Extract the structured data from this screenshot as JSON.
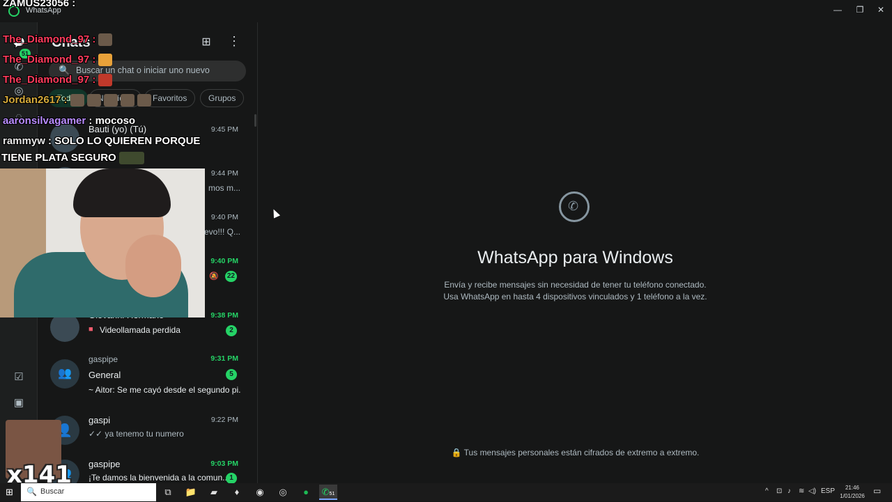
{
  "window": {
    "title": "WhatsApp",
    "controls": [
      "—",
      "❐",
      "✕"
    ]
  },
  "rail": {
    "badge": "51",
    "icons": [
      "chats-icon",
      "calls-icon",
      "status-icon",
      "channels-icon",
      "communities-icon",
      "starred-icon",
      "media-icon"
    ]
  },
  "sidebar": {
    "title": "Chats",
    "search_placeholder": "Buscar un chat o iniciar uno nuevo",
    "filters": [
      "Todos",
      "No leídos",
      "Favoritos",
      "Grupos"
    ],
    "chats": [
      {
        "name": "Bauti (yo) (Tú)",
        "sub": "",
        "time": "9:45 PM",
        "time_green": false,
        "badge": ""
      },
      {
        "name": "",
        "sub": "mos m...",
        "time": "9:44 PM",
        "time_green": false,
        "badge": ""
      },
      {
        "name": "",
        "sub": "evo!!! Q...",
        "time": "9:40 PM",
        "time_green": false,
        "badge": ""
      },
      {
        "name": "",
        "sub": "",
        "time": "9:40 PM",
        "time_green": true,
        "badge": "22",
        "muted": true
      },
      {
        "name": "Giovanni Hermano",
        "sub": "Videollamada perdida",
        "time": "9:38 PM",
        "time_green": true,
        "badge": "2"
      },
      {
        "name": "gaspipe",
        "title2": "General",
        "sub": "~ Aitor: Se me cayó desde el segundo pi...",
        "time": "9:31 PM",
        "time_green": true,
        "badge": "5"
      },
      {
        "name": "gaspi",
        "sub": "✓✓ ya tenemo tu numero",
        "time": "9:22 PM",
        "time_green": false,
        "badge": ""
      },
      {
        "name": "gaspipe",
        "sub": "¡Te damos la bienvenida a la comun...",
        "time": "9:03 PM",
        "time_green": true,
        "badge": "1"
      }
    ]
  },
  "main": {
    "title": "WhatsApp para Windows",
    "line1": "Envía y recibe mensajes sin necesidad de tener tu teléfono conectado.",
    "line2": "Usa WhatsApp en hasta 4 dispositivos vinculados y 1 teléfono a la vez.",
    "encrypt": "Tus mensajes personales están cifrados de extremo a extremo."
  },
  "stream_chat": [
    {
      "user": "ZAMUS23056",
      "msg": "",
      "color": "#ffffff"
    },
    {
      "user": "The_Diamond_97",
      "msg": "",
      "color": "#ff3b5c"
    },
    {
      "user": "The_Diamond_97",
      "msg": "",
      "color": "#ff3b5c"
    },
    {
      "user": "The_Diamond_97",
      "msg": "",
      "color": "#ff3b5c"
    },
    {
      "user": "Jordan2617",
      "msg": "",
      "color": "#d4a93a"
    },
    {
      "user": "aaronsilvagamer",
      "msg": "mocoso",
      "color": "#b98cff"
    },
    {
      "user": "rammyw",
      "msg": "SOLO LO QUIEREN PORQUE",
      "color": "#e8e8e8"
    },
    {
      "user": "",
      "msg": "TIENE PLATA SEGURO",
      "color": "#ffffff"
    }
  ],
  "meme_count": "x141",
  "taskbar": {
    "search": "Buscar",
    "whatsapp_badge": "51",
    "lang": "ESP",
    "time": "21:46",
    "date": "1/01/2026"
  }
}
